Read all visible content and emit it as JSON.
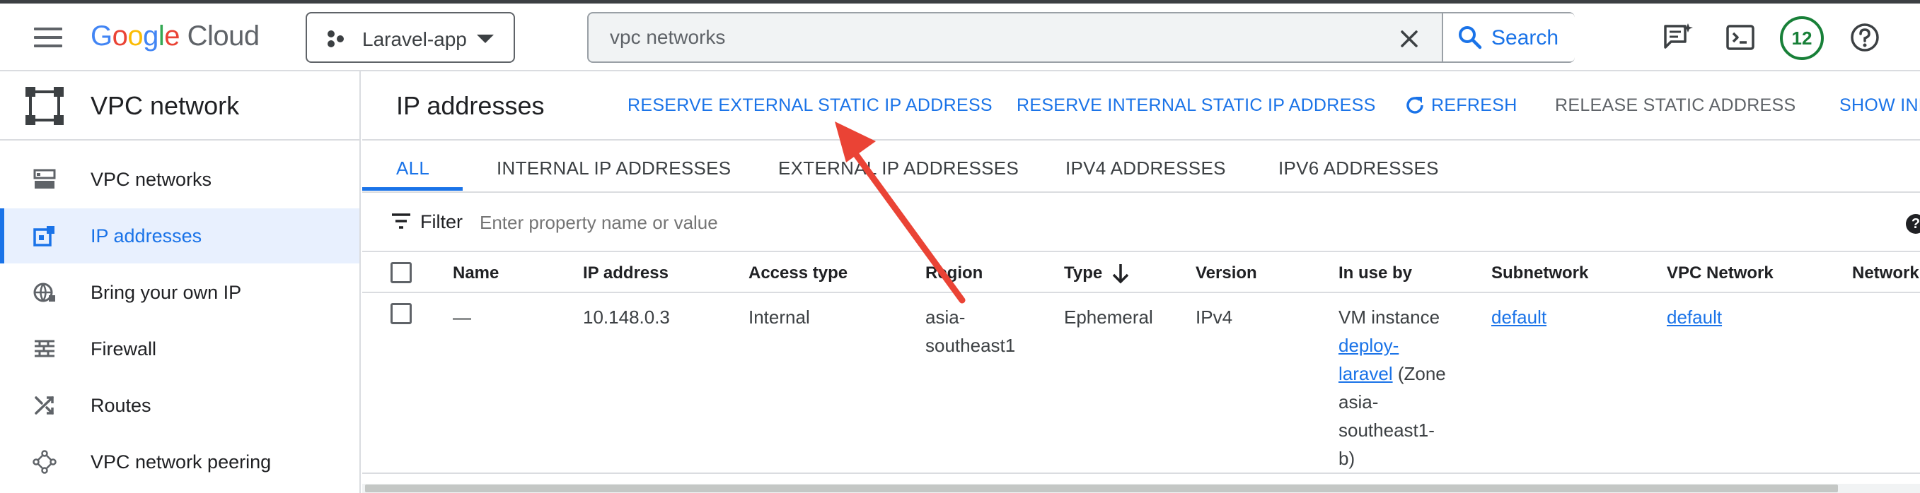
{
  "header": {
    "logo_google": [
      "G",
      "o",
      "o",
      "g",
      "l",
      "e"
    ],
    "logo_cloud": "Cloud",
    "project_name": "Laravel-app",
    "search_value": "vpc networks",
    "search_button": "Search",
    "notification_count": "12",
    "icons": [
      "menu-icon",
      "project-icon",
      "close-icon",
      "search-icon",
      "notes-icon",
      "cloud-shell-icon",
      "help-icon"
    ]
  },
  "sidebar": {
    "title": "VPC network",
    "items": [
      {
        "label": "VPC networks",
        "icon": "vpc-networks-icon",
        "active": false
      },
      {
        "label": "IP addresses",
        "icon": "ip-addresses-icon",
        "active": true
      },
      {
        "label": "Bring your own IP",
        "icon": "globe-icon",
        "active": false
      },
      {
        "label": "Firewall",
        "icon": "firewall-icon",
        "active": false
      },
      {
        "label": "Routes",
        "icon": "routes-icon",
        "active": false
      },
      {
        "label": "VPC network peering",
        "icon": "peering-icon",
        "active": false
      }
    ]
  },
  "page": {
    "title": "IP addresses",
    "actions": {
      "reserve_external": "RESERVE EXTERNAL STATIC IP ADDRESS",
      "reserve_internal": "RESERVE INTERNAL STATIC IP ADDRESS",
      "refresh": "REFRESH",
      "release": "RELEASE STATIC ADDRESS",
      "show_info": "SHOW INF"
    },
    "tabs": [
      "ALL",
      "INTERNAL IP ADDRESSES",
      "EXTERNAL IP ADDRESSES",
      "IPV4 ADDRESSES",
      "IPV6 ADDRESSES"
    ],
    "active_tab": "ALL",
    "filter_label": "Filter",
    "filter_placeholder": "Enter property name or value"
  },
  "table": {
    "columns": [
      "Name",
      "IP address",
      "Access type",
      "Region",
      "Type",
      "Version",
      "In use by",
      "Subnetwork",
      "VPC Network",
      "Network"
    ],
    "sorted_column": "Type",
    "rows": [
      {
        "name": "—",
        "ip_address": "10.148.0.3",
        "access_type": "Internal",
        "region_line1": "asia-",
        "region_line2": "southeast1",
        "type": "Ephemeral",
        "version": "IPv4",
        "in_use_by_prefix": "VM instance",
        "in_use_by_link1": "deploy-",
        "in_use_by_link2": "laravel",
        "in_use_by_suffix1": " (Zone",
        "in_use_by_suffix2": "asia-",
        "in_use_by_suffix3": "southeast1-",
        "in_use_by_suffix4": "b)",
        "subnetwork": "default",
        "vpc_network": "default"
      }
    ]
  },
  "colors": {
    "accent": "#1a73e8",
    "annotation_arrow": "#ea4335",
    "badge": "#188038"
  }
}
